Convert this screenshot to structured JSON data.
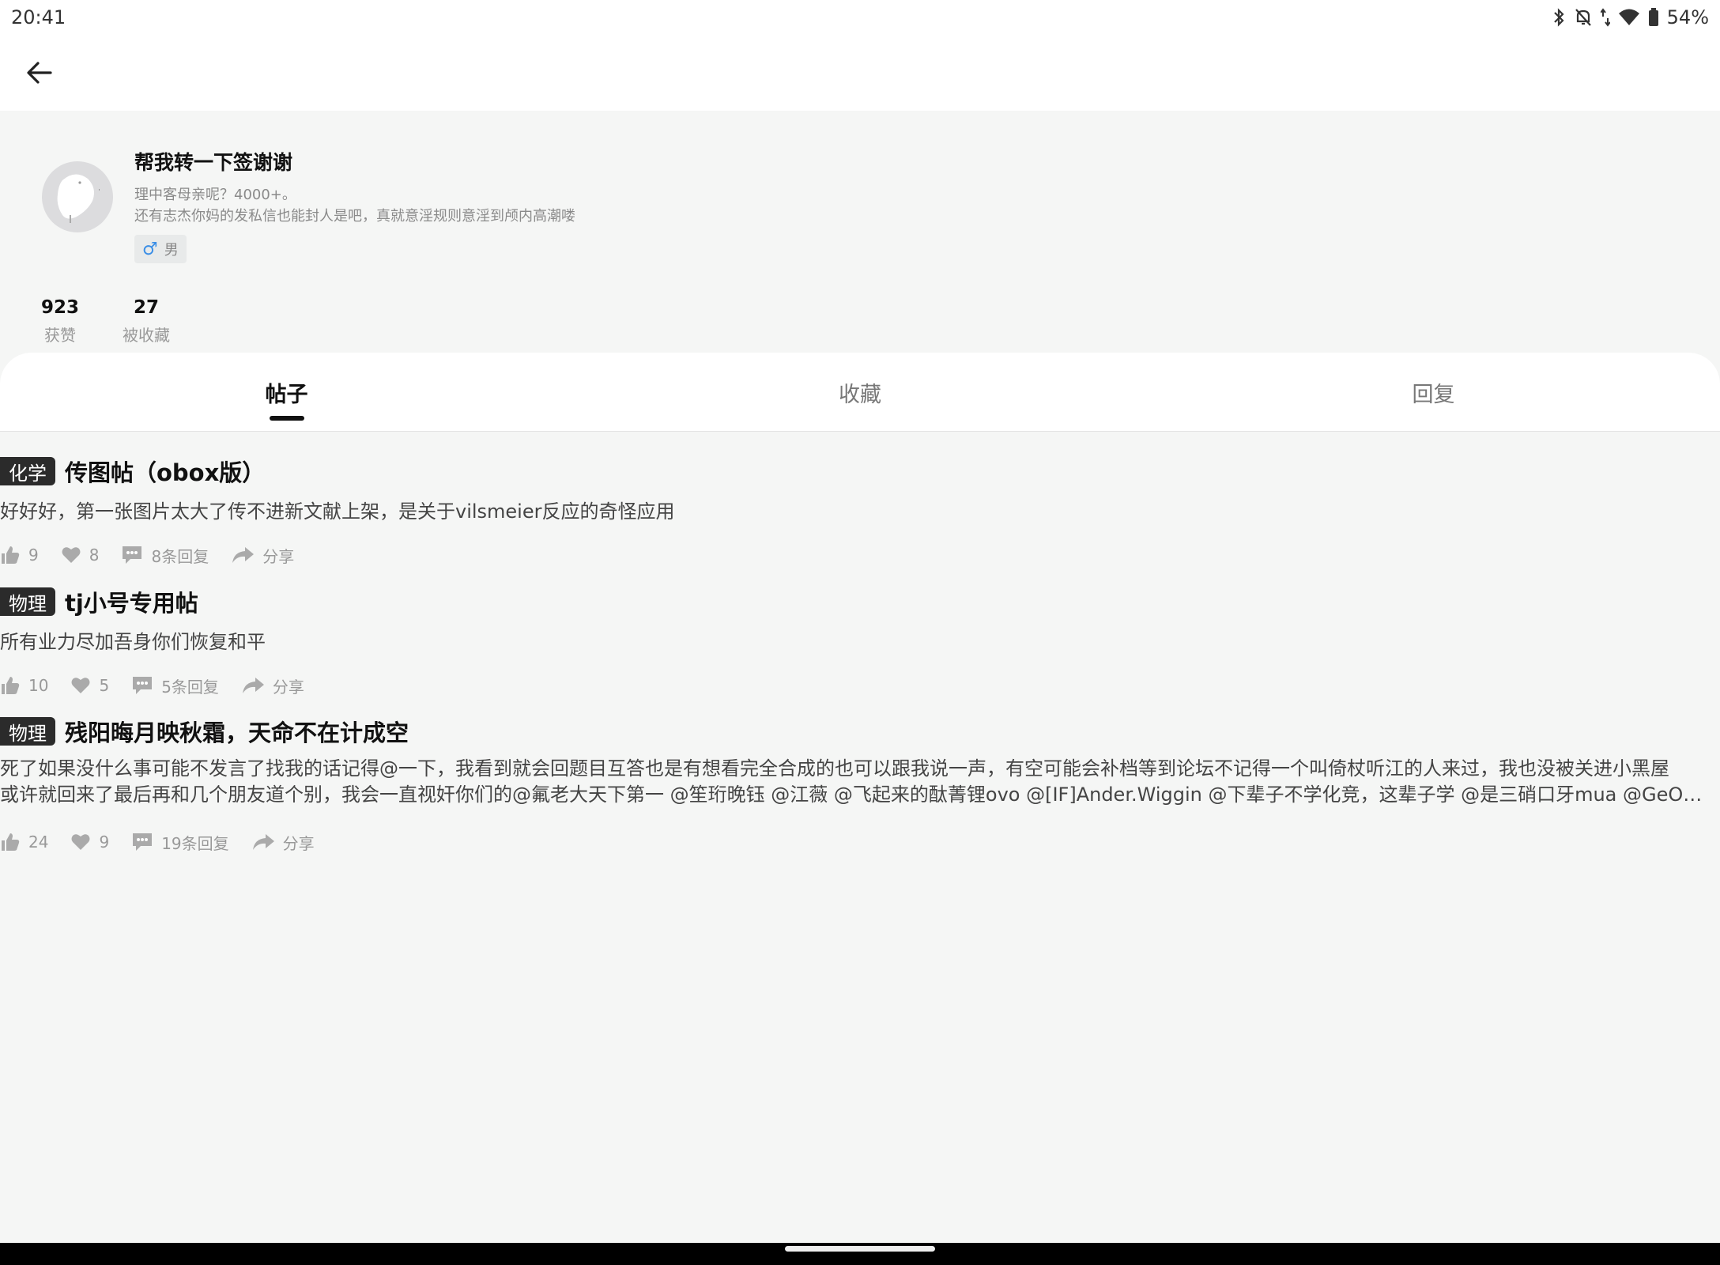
{
  "status": {
    "time": "20:41",
    "battery": "54%"
  },
  "profile": {
    "name": "帮我转一下签谢谢",
    "bio_line1": "理中客母亲呢？4000+。",
    "bio_line2": "还有志杰你妈的发私信也能封人是吧，真就意淫规则意淫到颅内高潮喽",
    "gender": "男",
    "stats": [
      {
        "value": "923",
        "label": "获赞"
      },
      {
        "value": "27",
        "label": "被收藏"
      }
    ]
  },
  "tabs": [
    {
      "label": "帖子",
      "active": true
    },
    {
      "label": "收藏",
      "active": false
    },
    {
      "label": "回复",
      "active": false
    }
  ],
  "posts": [
    {
      "tag": "化学",
      "title": "传图帖（obox版）",
      "body": [
        "好好好，第一张图片太大了传不进新文献上架，是关于vilsmeier反应的奇怪应用"
      ],
      "likes": "9",
      "favorites": "8",
      "replies": "8条回复",
      "share": "分享"
    },
    {
      "tag": "物理",
      "title": "tj小号专用帖",
      "body": [
        "所有业力尽加吾身你们恢复和平"
      ],
      "likes": "10",
      "favorites": "5",
      "replies": "5条回复",
      "share": "分享"
    },
    {
      "tag": "物理",
      "title": "残阳晦月映秋霜，天命不在计成空",
      "body": [
        "死了如果没什么事可能不发言了找我的话记得@一下，我看到就会回题目互答也是有想看完全合成的也可以跟我说一声，有空可能会补档等到论坛不记得一个叫倚杖听江的人来过，我也没被关进小黑屋",
        "或许就回来了最后再和几个朋友道个别，我会一直视奸你们的@氟老大天下第一 @笙珩晚钰 @江薇 @飞起来的酞菁锂ovo @[IF]Ander.Wiggin @下辈子不学化竞，这辈子学 @是三硝口牙mua @GeO @..."
      ],
      "likes": "24",
      "favorites": "9",
      "replies": "19条回复",
      "share": "分享"
    }
  ]
}
